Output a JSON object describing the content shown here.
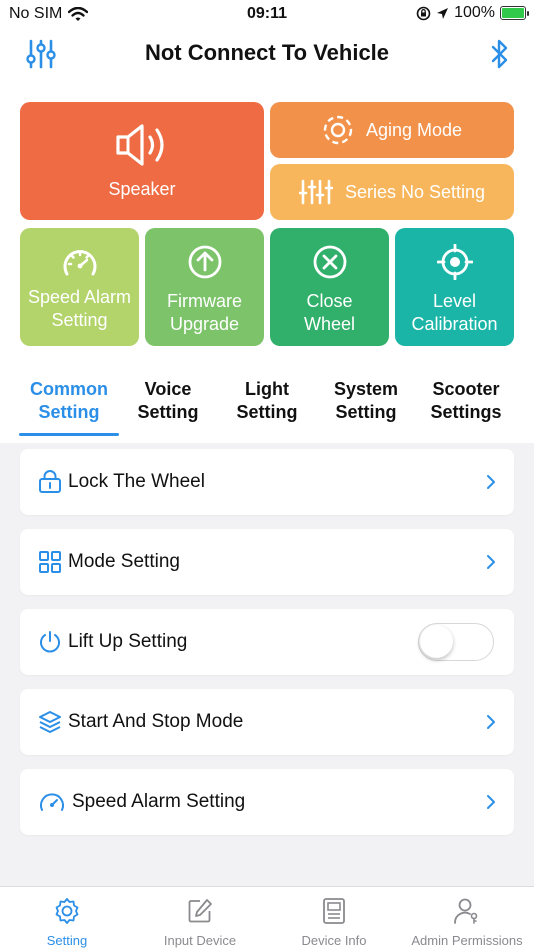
{
  "status_bar": {
    "carrier": "No SIM",
    "time": "09:11",
    "battery": "100%"
  },
  "header": {
    "title": "Not Connect To Vehicle",
    "left_icon": "sliders-icon",
    "right_icon": "bluetooth-icon"
  },
  "tiles": {
    "speaker": {
      "label": "Speaker",
      "icon": "speaker-icon",
      "color": "#ee6b43"
    },
    "aging_mode": {
      "label": "Aging Mode",
      "icon": "aging-icon",
      "color": "#f2914a"
    },
    "series_no": {
      "label": "Series No Setting",
      "icon": "equalizer-icon",
      "color": "#f7b65b"
    },
    "speed_alarm": {
      "line1": "Speed Alarm",
      "line2": "Setting",
      "icon": "speedometer-icon",
      "color": "#b3d36b"
    },
    "firmware": {
      "line1": "Firmware",
      "line2": "Upgrade",
      "icon": "upload-icon",
      "color": "#7cc36a"
    },
    "close_wheel": {
      "line1": "Close",
      "line2": "Wheel",
      "icon": "close-circle-icon",
      "color": "#31b06b"
    },
    "level_cal": {
      "line1": "Level",
      "line2": "Calibration",
      "icon": "crosshair-icon",
      "color": "#1bb5a8"
    }
  },
  "tabs": [
    {
      "line1": "Common",
      "line2": "Setting",
      "active": true
    },
    {
      "line1": "Voice",
      "line2": "Setting",
      "active": false
    },
    {
      "line1": "Light",
      "line2": "Setting",
      "active": false
    },
    {
      "line1": "System",
      "line2": "Setting",
      "active": false
    },
    {
      "line1": "Scooter",
      "line2": "Settings",
      "active": false
    }
  ],
  "settings": [
    {
      "label": "Lock The Wheel",
      "icon": "lock-icon",
      "control": "chevron"
    },
    {
      "label": "Mode Setting",
      "icon": "grid-icon",
      "control": "chevron"
    },
    {
      "label": "Lift Up Setting",
      "icon": "power-icon",
      "control": "toggle",
      "toggle_on": false
    },
    {
      "label": "Start And Stop Mode",
      "icon": "layers-icon",
      "control": "chevron"
    },
    {
      "label": "Speed Alarm Setting",
      "icon": "speedometer-icon",
      "control": "chevron"
    }
  ],
  "bottom_tabs": [
    {
      "label": "Setting",
      "icon": "gear-icon",
      "active": true
    },
    {
      "label": "Input Device",
      "icon": "edit-icon",
      "active": false
    },
    {
      "label": "Device Info",
      "icon": "document-icon",
      "active": false
    },
    {
      "label": "Admin Permissions",
      "icon": "user-key-icon",
      "active": false
    }
  ],
  "colors": {
    "accent": "#2b8fe8",
    "background": "#f2f2f4"
  }
}
